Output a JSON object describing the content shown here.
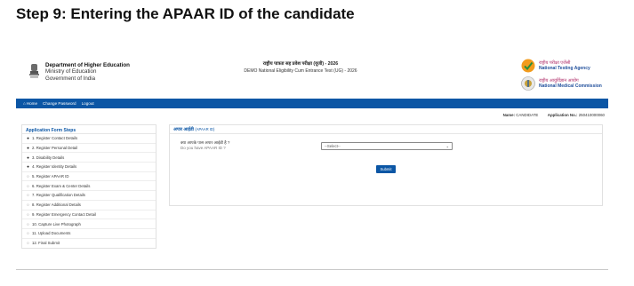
{
  "step_title": "Step 9: Entering the APAAR ID of the candidate",
  "header": {
    "dept_line1": "Department of Higher Education",
    "dept_line2": "Ministry of Education",
    "dept_line3": "Government of India",
    "exam_title_hindi": "राष्ट्रीय पात्रता सह प्रवेश परीक्षा (यूजी) - 2026",
    "exam_title_english": "DEMO National Eligibility Cum Entrance Test (UG) - 2026",
    "nta_hindi": "राष्ट्रीय परीक्षा एजेंसी",
    "nta_english": "National Testing Agency",
    "nmc_hindi": "राष्ट्रीय आयुर्विज्ञान आयोग",
    "nmc_english": "National Medical Commission"
  },
  "navbar": {
    "home": "Home",
    "change_password": "Change Password",
    "logout": "Logout"
  },
  "candidate": {
    "name_label": "Name:",
    "name_value": "CANDIDATE",
    "appno_label": "Application No.:",
    "appno_value": "250410000060"
  },
  "sidebar": {
    "title": "Application Form Steps",
    "items": [
      {
        "label": "1. Register Contact Details",
        "done": true
      },
      {
        "label": "2. Register Personal Detail",
        "done": true
      },
      {
        "label": "3. Disability Details",
        "done": true
      },
      {
        "label": "4. Register Identity Details",
        "done": true
      },
      {
        "label": "5. Register APAAR ID",
        "done": false
      },
      {
        "label": "6. Register Exam & Center Details",
        "done": false
      },
      {
        "label": "7. Register Qualification Details",
        "done": false
      },
      {
        "label": "8. Register Additional Details",
        "done": false
      },
      {
        "label": "9. Register Emergency Contact Detail",
        "done": false
      },
      {
        "label": "10. Capture Live Photograph",
        "done": false
      },
      {
        "label": "11. Upload Documents",
        "done": false
      },
      {
        "label": "12. Final Submit",
        "done": false
      }
    ]
  },
  "panel": {
    "title_hindi": "अपार आईडी",
    "title_english": "(APAAR ID)",
    "question_hindi": "क्या आपके पास अपार आईडी है ?",
    "question_english": "Do you have APAAR ID ?",
    "select_value": "--Select--",
    "submit_label": "Submit"
  },
  "colors": {
    "brand_blue": "#0b56a5"
  }
}
